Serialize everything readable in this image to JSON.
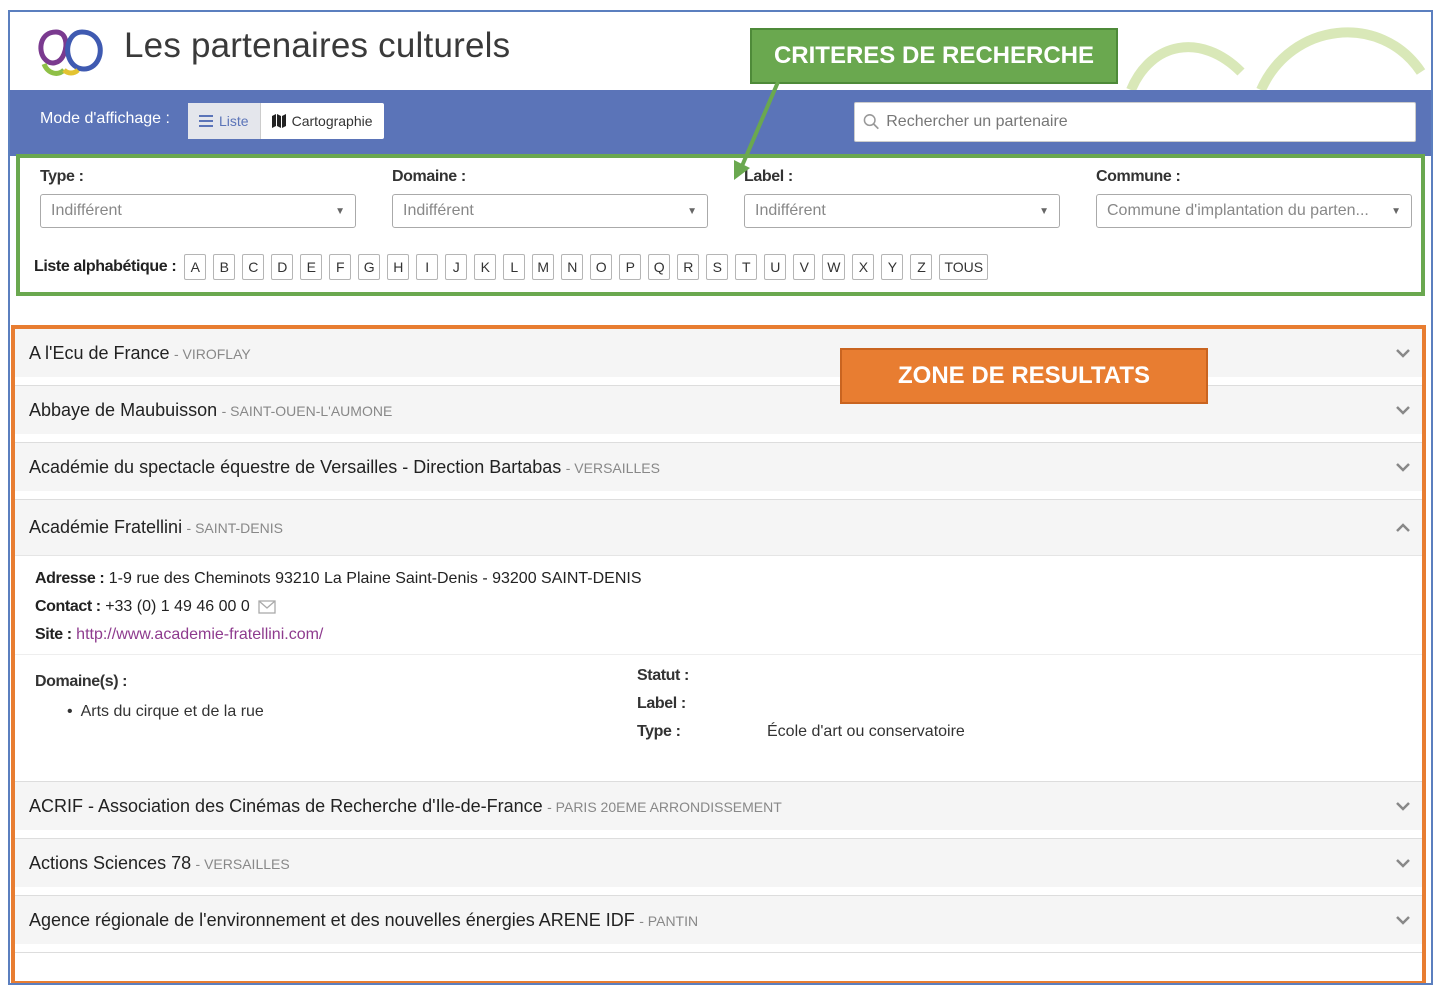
{
  "header": {
    "title": "Les partenaires culturels",
    "colors": {
      "logo_purple": "#7a3a8f",
      "logo_blue": "#3f5ab1",
      "logo_green": "#8fc047",
      "logo_yellow": "#e3c331"
    }
  },
  "toolbar": {
    "mode_label": "Mode d'affichage :",
    "mode_list": "Liste",
    "mode_map": "Cartographie",
    "search_placeholder": "Rechercher un partenaire",
    "bg_color": "#5b74b8"
  },
  "filters": {
    "type": {
      "label": "Type :",
      "value": "Indifférent"
    },
    "domaine": {
      "label": "Domaine :",
      "value": "Indifférent"
    },
    "label": {
      "label": "Label :",
      "value": "Indifférent"
    },
    "commune": {
      "label": "Commune :",
      "value": "Commune d'implantation du parten..."
    },
    "alpha_label": "Liste alphabétique :",
    "letters": [
      "A",
      "B",
      "C",
      "D",
      "E",
      "F",
      "G",
      "H",
      "I",
      "J",
      "K",
      "L",
      "M",
      "N",
      "O",
      "P",
      "Q",
      "R",
      "S",
      "T",
      "U",
      "V",
      "W",
      "X",
      "Y",
      "Z",
      "TOUS"
    ]
  },
  "callouts": {
    "criteria": "CRITERES DE RECHERCHE",
    "results": "ZONE DE RESULTATS",
    "green": "#6aa84f",
    "orange": "#e87d31"
  },
  "results": {
    "items": [
      {
        "title": "A l'Ecu de France",
        "city": "- VIROFLAY",
        "expanded": false
      },
      {
        "title": "Abbaye de Maubuisson",
        "city": "- SAINT-OUEN-L'AUMONE",
        "expanded": false
      },
      {
        "title": "Académie du spectacle équestre de Versailles - Direction Bartabas",
        "city": "- VERSAILLES",
        "expanded": false
      },
      {
        "title": "Académie Fratellini",
        "city": "- SAINT-DENIS",
        "expanded": true
      },
      {
        "title": "ACRIF - Association des Cinémas de Recherche d'Ile-de-France",
        "city": "- PARIS 20EME ARRONDISSEMENT",
        "expanded": false
      },
      {
        "title": "Actions Sciences 78",
        "city": "- VERSAILLES",
        "expanded": false
      },
      {
        "title": "Agence régionale de l'environnement et des nouvelles énergies ARENE IDF",
        "city": "- PANTIN",
        "expanded": false
      }
    ],
    "detail": {
      "address_label": "Adresse :",
      "address": "1-9 rue des Cheminots 93210 La Plaine Saint-Denis - 93200 SAINT-DENIS",
      "contact_label": "Contact :",
      "contact": "+33 (0) 1 49 46 00 0",
      "site_label": "Site :",
      "site": "http://www.academie-fratellini.com/",
      "domaines_label": "Domaine(s) :",
      "domaines": [
        "Arts du cirque et de la rue"
      ],
      "statut_label": "Statut :",
      "statut": "",
      "label_label": "Label :",
      "label_value": "",
      "type_label": "Type :",
      "type_value": "École d'art ou conservatoire"
    }
  }
}
